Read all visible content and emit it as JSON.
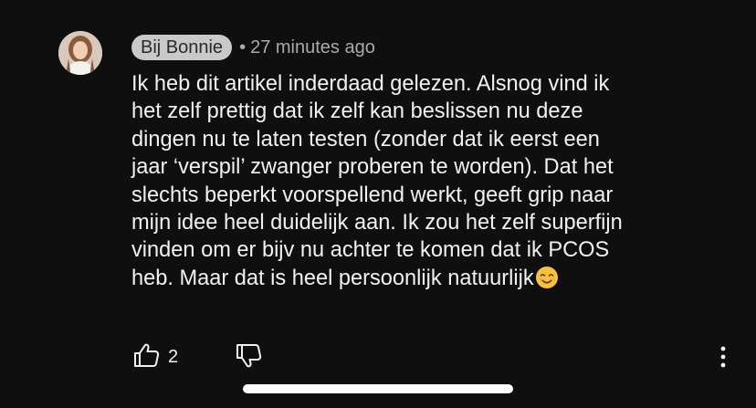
{
  "comment": {
    "author": "Bij Bonnie",
    "separator": "•",
    "timestamp": "27 minutes ago",
    "text_lines": [
      "Ik heb dit artikel inderdaad gelezen. Alsnog vind ik",
      "het zelf prettig dat ik zelf kan beslissen nu deze",
      "dingen nu te laten testen (zonder dat ik eerst een",
      "jaar ‘verspil’ zwanger proberen te worden). Dat het",
      "slechts beperkt voorspellend werkt, geeft grip naar",
      "mijn idee heel duidelijk aan. Ik zou het zelf superfijn",
      "vinden om er bijv nu achter te komen dat ik PCOS",
      "heb. Maar dat is heel persoonlijk natuurlijk"
    ],
    "like_count": "2"
  },
  "icons": {
    "like": "thumbs-up-icon",
    "dislike": "thumbs-down-icon",
    "more": "vertical-dots-icon",
    "emoji": "smiling-face-emoji"
  },
  "colors": {
    "background": "#0f0f0f",
    "text": "#f1f1f1",
    "secondary_text": "#aaaaaa",
    "author_chip": "#c9c9c9"
  }
}
